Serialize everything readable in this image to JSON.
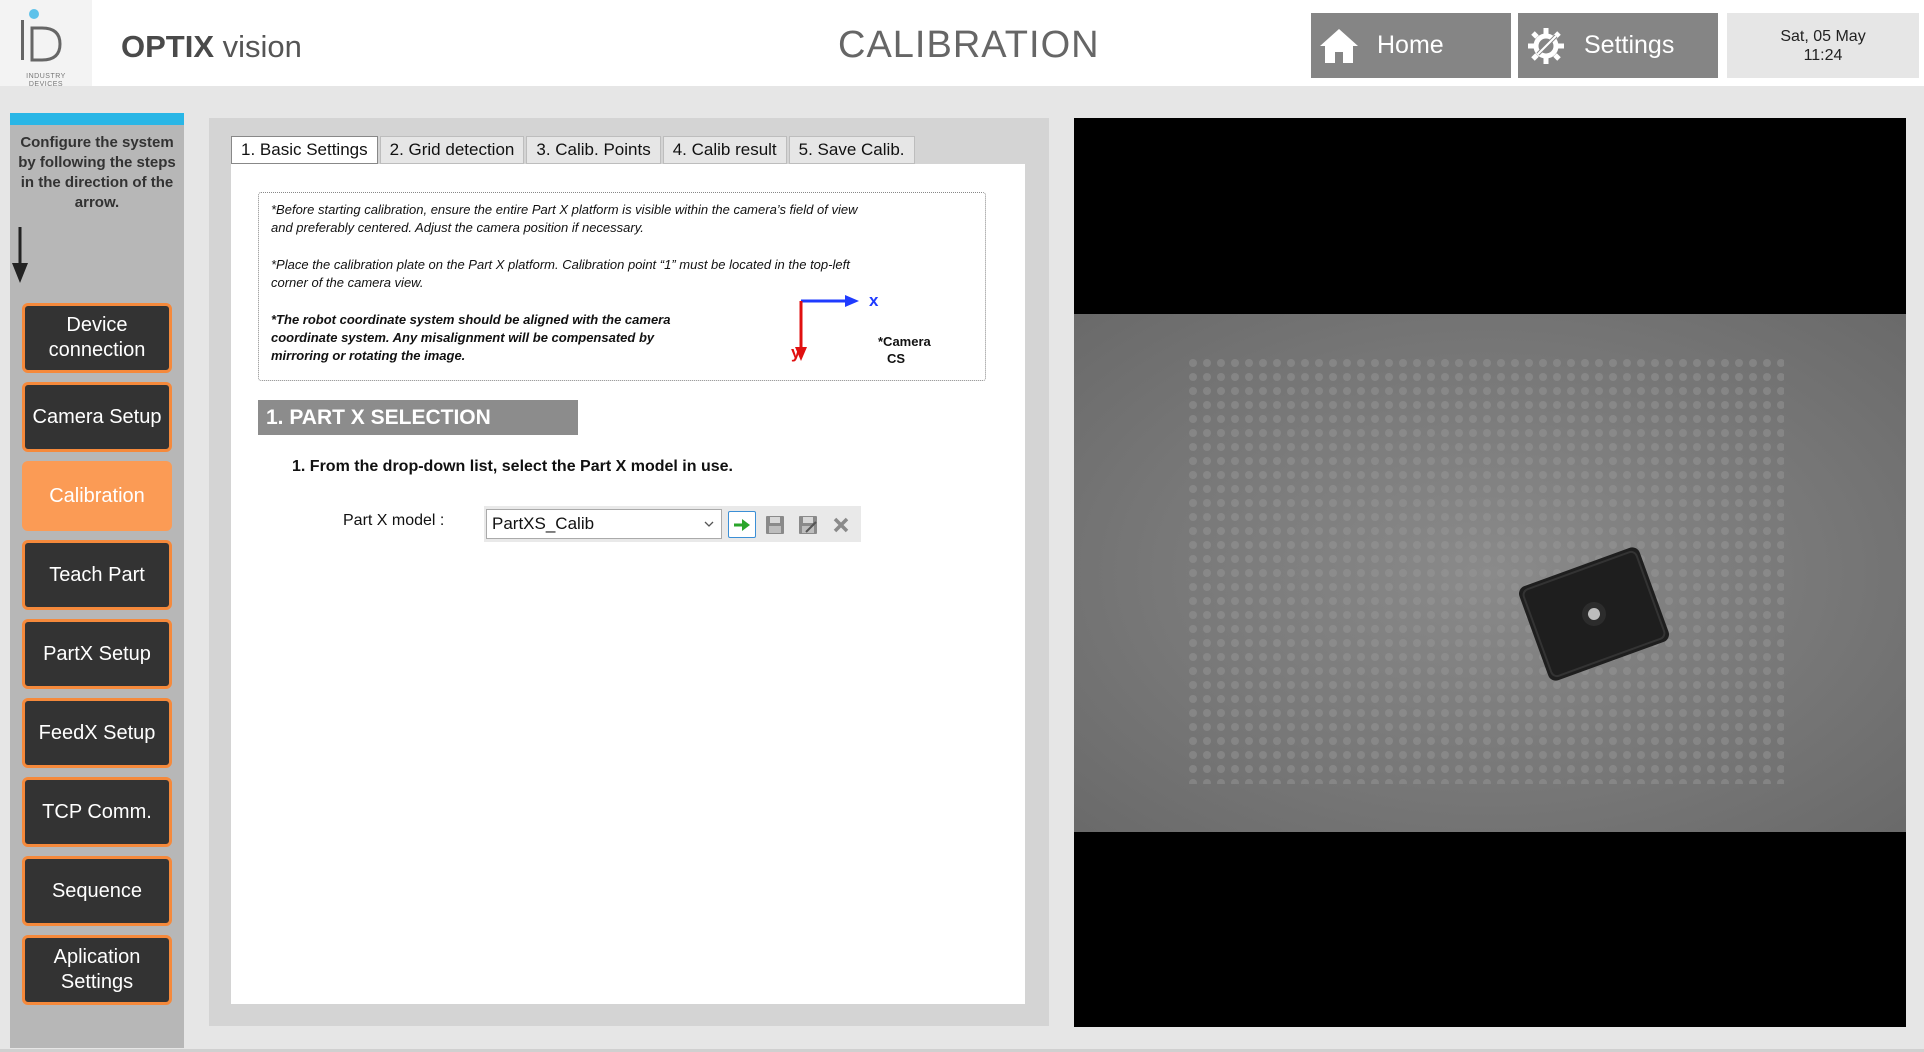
{
  "header": {
    "logo_text": "INDUSTRY DEVICES",
    "app_name_bold": "OPTIX",
    "app_name_rest": " vision",
    "page_title": "CALIBRATION",
    "home_label": "Home",
    "settings_label": "Settings",
    "date": "Sat, 05 May",
    "time": "11:24"
  },
  "sidebar": {
    "info": "Configure the system by following the steps in the direction of the arrow.",
    "items": [
      {
        "label": "Device connection",
        "active": false
      },
      {
        "label": "Camera Setup",
        "active": false
      },
      {
        "label": "Calibration",
        "active": true
      },
      {
        "label": "Teach Part",
        "active": false
      },
      {
        "label": "PartX Setup",
        "active": false
      },
      {
        "label": "FeedX Setup",
        "active": false
      },
      {
        "label": "TCP Comm.",
        "active": false
      },
      {
        "label": "Sequence",
        "active": false
      },
      {
        "label": "Aplication Settings",
        "active": false
      }
    ]
  },
  "tabs": [
    {
      "label": "1. Basic Settings",
      "active": true
    },
    {
      "label": "2. Grid detection",
      "active": false
    },
    {
      "label": "3. Calib. Points",
      "active": false
    },
    {
      "label": "4. Calib result",
      "active": false
    },
    {
      "label": "5. Save Calib.",
      "active": false
    }
  ],
  "notes": {
    "line1a": "*Before starting calibration, ensure the entire Part X platform is visible within the camera’s field of view",
    "line1b": "and preferably centered. Adjust the camera position if necessary.",
    "line2a": "*Place the calibration plate on the Part X platform. Calibration point “1” must be located in the top-left",
    "line2b": "corner of the camera view.",
    "line3a": "*The robot coordinate system should be aligned with the camera",
    "line3b": "coordinate system. Any misalignment will be compensated by",
    "line3c": "mirroring or rotating the image.",
    "axis_x": "x",
    "axis_y": "y",
    "cam_cs_1": "*Camera",
    "cam_cs_2": "CS"
  },
  "section": {
    "title": "1. PART X SELECTION",
    "instruction": "1. From the drop-down list, select the Part X model in use.",
    "model_label": "Part X model :",
    "model_value": "PartXS_Calib"
  },
  "colors": {
    "accent_orange": "#f5893b",
    "active_orange": "#fb9b55",
    "stripe_blue": "#29b6e6",
    "axis_x_blue": "#1f3bff",
    "axis_y_red": "#e01010"
  },
  "icons": {
    "home": "home-icon",
    "settings": "gear-wrench-icon",
    "load": "arrow-right-icon",
    "save": "floppy-icon",
    "save_as": "floppy-edit-icon",
    "delete": "close-icon"
  }
}
